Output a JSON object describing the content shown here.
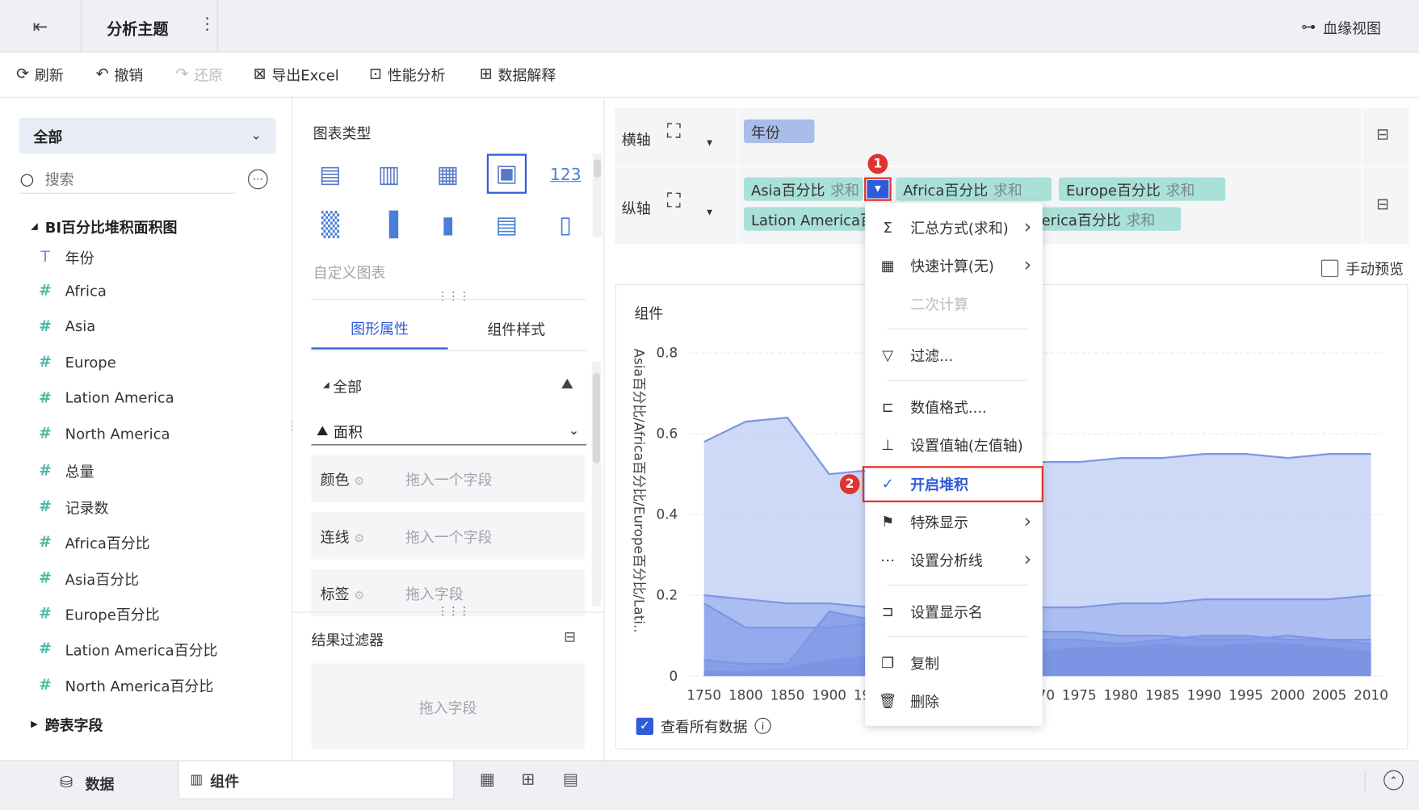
{
  "header": {
    "title": "分析主题",
    "lineage": "血缘视图"
  },
  "toolbar": {
    "refresh": "刷新",
    "undo": "撤销",
    "redo": "还原",
    "export": "导出Excel",
    "perf": "性能分析",
    "explain": "数据解释"
  },
  "left": {
    "scope": "全部",
    "search_placeholder": "搜索",
    "group": "BI百分比堆积面积图",
    "fields": [
      {
        "type": "T",
        "label": "年份"
      },
      {
        "type": "#",
        "label": "Africa"
      },
      {
        "type": "#",
        "label": "Asia"
      },
      {
        "type": "#",
        "label": "Europe"
      },
      {
        "type": "#",
        "label": "Lation America"
      },
      {
        "type": "#",
        "label": "North America"
      },
      {
        "type": "#",
        "label": "总量"
      },
      {
        "type": "#",
        "label": "记录数"
      },
      {
        "type": "#",
        "label": "Africa百分比"
      },
      {
        "type": "#",
        "label": "Asia百分比"
      },
      {
        "type": "#",
        "label": "Europe百分比"
      },
      {
        "type": "#",
        "label": "Lation America百分比"
      },
      {
        "type": "#",
        "label": "North America百分比"
      }
    ],
    "group2": "跨表字段"
  },
  "middle": {
    "chart_type": "图表类型",
    "custom": "自定义图表",
    "tab_props": "图形属性",
    "tab_style": "组件样式",
    "all": "全部",
    "area": "面积",
    "color": "颜色",
    "line": "连线",
    "label": "标签",
    "drag_one": "拖入一个字段",
    "drag": "拖入字段",
    "filter_title": "结果过滤器"
  },
  "axes": {
    "x_label": "横轴",
    "y_label": "纵轴",
    "x_field": "年份",
    "y_fields": [
      {
        "name": "Asia百分比",
        "agg": "求和"
      },
      {
        "name": "Africa百分比",
        "agg": "求和"
      },
      {
        "name": "Europe百分比",
        "agg": "求和"
      },
      {
        "name": "Lation America百",
        "agg": ""
      },
      {
        "name": "erica百分比",
        "agg": "求和"
      }
    ],
    "manual_preview": "手动预览"
  },
  "chart": {
    "title": "组件",
    "y_axis_title": "Asia百分比/Africa百分比/Europe百分比/Lati..",
    "view_all": "查看所有数据"
  },
  "chart_data": {
    "type": "area",
    "x": [
      "1750",
      "1800",
      "1850",
      "1900",
      "1950",
      "1955",
      "1960",
      "1965",
      "1970",
      "1975",
      "1980",
      "1985",
      "1990",
      "1995",
      "2000",
      "2005",
      "2010"
    ],
    "x_visible_ticks": [
      "1750",
      "1800",
      "1850",
      "1900",
      "19",
      "70",
      "1975",
      "1980",
      "1985",
      "1990",
      "1995",
      "2000",
      "2005",
      "2010"
    ],
    "yticks": [
      "0.8",
      "0.6",
      "0.4",
      "0.2",
      "0"
    ],
    "ylim": [
      0,
      0.8
    ],
    "stacked": false,
    "series": [
      {
        "values": [
          0.58,
          0.63,
          0.64,
          0.5,
          0.51,
          0.52,
          0.53,
          0.53,
          0.53,
          0.53,
          0.54,
          0.54,
          0.55,
          0.55,
          0.54,
          0.55,
          0.55
        ]
      },
      {
        "values": [
          0.2,
          0.19,
          0.18,
          0.18,
          0.17,
          0.17,
          0.17,
          0.17,
          0.17,
          0.17,
          0.18,
          0.18,
          0.19,
          0.19,
          0.19,
          0.19,
          0.2
        ]
      },
      {
        "values": [
          0.18,
          0.12,
          0.12,
          0.12,
          0.13,
          0.13,
          0.12,
          0.12,
          0.11,
          0.11,
          0.1,
          0.1,
          0.09,
          0.09,
          0.1,
          0.09,
          0.09
        ]
      },
      {
        "values": [
          0.04,
          0.03,
          0.03,
          0.16,
          0.14,
          0.13,
          0.11,
          0.1,
          0.09,
          0.09,
          0.08,
          0.09,
          0.1,
          0.1,
          0.09,
          0.09,
          0.08
        ]
      },
      {
        "values": [
          0.01,
          0.01,
          0.02,
          0.04,
          0.05,
          0.05,
          0.06,
          0.06,
          0.06,
          0.07,
          0.07,
          0.08,
          0.07,
          0.08,
          0.08,
          0.07,
          0.06
        ]
      }
    ],
    "colors": [
      "#c5d2f6",
      "#9db1ee",
      "#8aa2ea",
      "#7f98e6",
      "#7690e2"
    ]
  },
  "context_menu": {
    "items": [
      {
        "icon": "sigma-icon",
        "label": "汇总方式(求和)",
        "arrow": true
      },
      {
        "icon": "calculator-icon",
        "label": "快速计算(无)",
        "arrow": true
      },
      {
        "icon": "",
        "label": "二次计算",
        "disabled": true
      },
      {
        "icon": "filter-icon",
        "label": "过滤..."
      },
      {
        "icon": "number-format-icon",
        "label": "数值格式...."
      },
      {
        "icon": "value-axis-icon",
        "label": "设置值轴(左值轴)"
      },
      {
        "icon": "check-icon",
        "label": "开启堆积",
        "active": true
      },
      {
        "icon": "flag-icon",
        "label": "特殊显示",
        "arrow": true
      },
      {
        "icon": "analysis-line-icon",
        "label": "设置分析线",
        "arrow": true
      },
      {
        "icon": "rename-icon",
        "label": "设置显示名"
      },
      {
        "icon": "copy-icon",
        "label": "复制"
      },
      {
        "icon": "delete-icon",
        "label": "删除"
      }
    ]
  },
  "annotations": {
    "badge1": "1",
    "badge2": "2"
  },
  "bottom": {
    "data_tab": "数据",
    "component_tab": "组件"
  },
  "accent": "#2f5bd8",
  "red": "#e0322e"
}
